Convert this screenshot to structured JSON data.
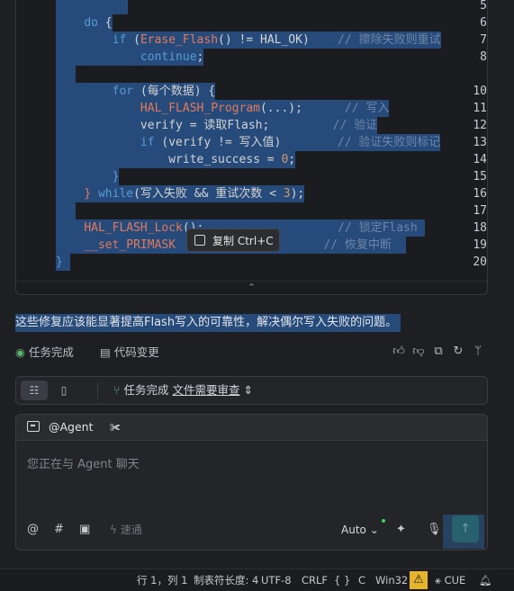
{
  "code": {
    "lines": [
      {
        "n": "5"
      },
      {
        "n": "6",
        "kw1": "do",
        "p1": " {"
      },
      {
        "n": "7",
        "kw1": "if",
        "p1": " (",
        "fn1": "Erase_Flash",
        "p2": "() != HAL_OK)",
        "cm": "// 擦除失败则重试"
      },
      {
        "n": "8",
        "kw1": "continue",
        "p1": ";"
      },
      {
        "n": "10",
        "kw1": "for",
        "p1": " (每个数据) {"
      },
      {
        "n": "11",
        "fn1": "HAL_FLASH_Program",
        "p1": "(...);",
        "cm": "// 写入"
      },
      {
        "n": "12",
        "p1": "verify = 读取Flash;",
        "cm": "// 验证"
      },
      {
        "n": "13",
        "kw1": "if",
        "p1": " (verify != 写入值)",
        "cm": "// 验证失败则标记"
      },
      {
        "n": "14",
        "p1": "write_success = ",
        "num": "0",
        "p2": ";"
      },
      {
        "n": "15",
        "p1": "}"
      },
      {
        "n": "16",
        "p1": "} ",
        "kw1": "while",
        "p2": "(写入失败 && 重试次数 < ",
        "num": "3",
        "p3": ");"
      },
      {
        "n": "17"
      },
      {
        "n": "18",
        "fn1": "HAL_FLASH_Lock",
        "p1": "();",
        "cm": "// 锁定Flash"
      },
      {
        "n": "19",
        "fn1": "__set_PRIMASK",
        "cm": "// 恢复中断"
      },
      {
        "n": "20",
        "p1": "}"
      }
    ],
    "collapse_icon": "chevron-up-icon"
  },
  "tooltip": {
    "label": "复制",
    "shortcut": "Ctrl+C"
  },
  "summary": "这些修复应该能显著提高Flash写入的可靠性，解决偶尔写入失败的问题。",
  "status": {
    "task_done": "任务完成",
    "code_changes": "代码变更"
  },
  "taskbar": {
    "status": "任务完成",
    "link": "文件需要审查"
  },
  "chat": {
    "agent": "@Agent",
    "placeholder": "您正在与 Agent 聊天",
    "speed": "速通",
    "model": "Auto"
  },
  "statusbar": {
    "position": "行 1，列 1",
    "tab": "制表符长度: 4",
    "encoding": "UTF-8",
    "eol": "CRLF",
    "braces": "{ }",
    "lang": "C",
    "platform": "Win32",
    "cue": "CUE"
  },
  "colors": {
    "selection": "#264a7a",
    "keyword": "#569cd6",
    "function": "#e07a5f",
    "comment": "#6e85a8",
    "warning": "#e5b42a",
    "send": "#1f6a4a"
  }
}
